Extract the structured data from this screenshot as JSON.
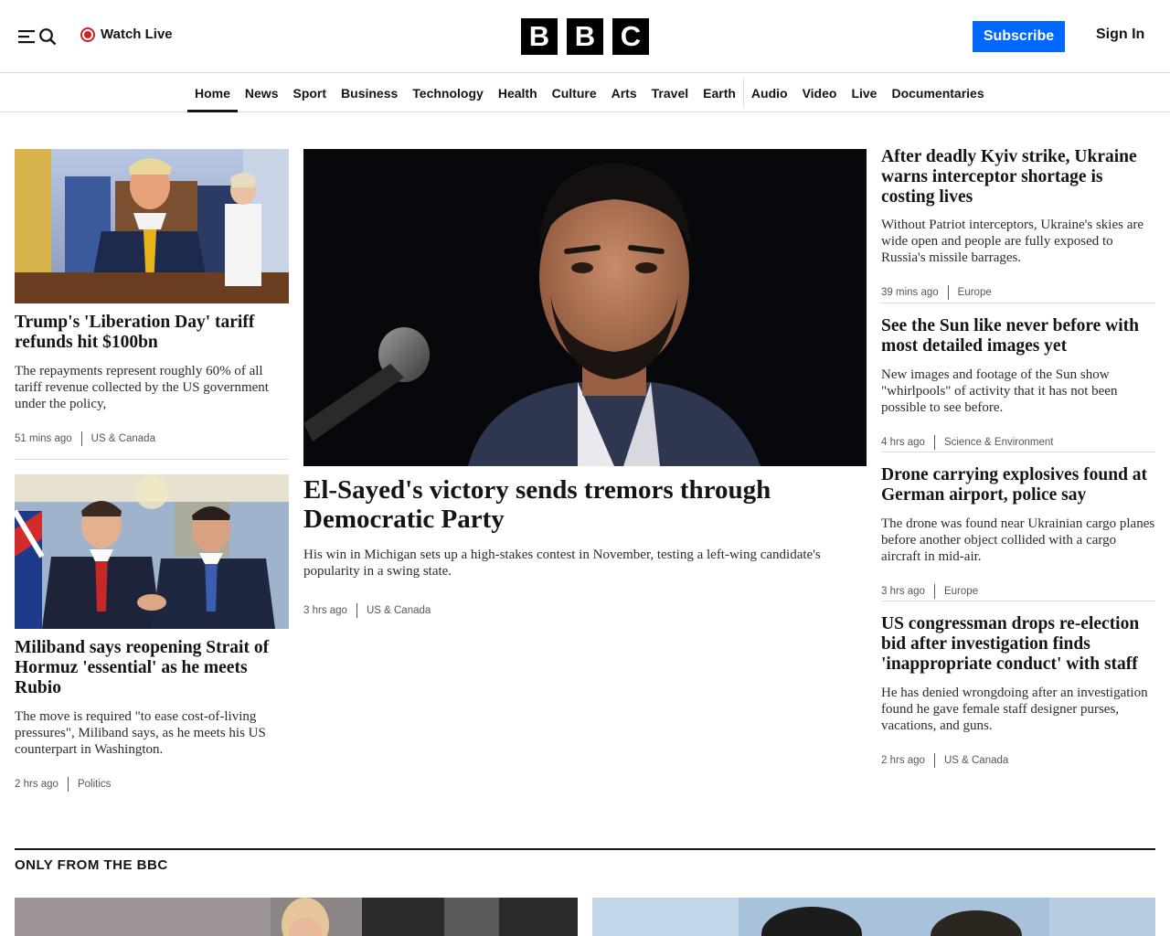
{
  "header": {
    "watch_live": "Watch Live",
    "logo_letters": [
      "B",
      "B",
      "C"
    ],
    "subscribe": "Subscribe",
    "sign_in": "Sign In"
  },
  "nav": {
    "items": [
      "Home",
      "News",
      "Sport",
      "Business",
      "Technology",
      "Health",
      "Culture",
      "Arts",
      "Travel",
      "Earth",
      "Audio",
      "Video",
      "Live",
      "Documentaries"
    ],
    "active": "Home"
  },
  "left_stories": [
    {
      "headline": "Trump's 'Liberation Day' tariff refunds hit $100bn",
      "summary": "The repayments represent roughly 60% of all tariff revenue collected by the US government under the policy,",
      "time": "51 mins ago",
      "section": "US & Canada"
    },
    {
      "headline": "Miliband says reopening Strait of Hormuz 'essential' as he meets Rubio",
      "summary": "The move is required \"to ease cost-of-living pressures\", Miliband says, as he meets his US counterpart in Washington.",
      "time": "2 hrs ago",
      "section": "Politics"
    }
  ],
  "main_story": {
    "headline": "El-Sayed's victory sends tremors through Democratic Party",
    "summary": "His win in Michigan sets up a high-stakes contest in November, testing a left-wing candidate's popularity in a swing state.",
    "time": "3 hrs ago",
    "section": "US & Canada"
  },
  "right_stories": [
    {
      "headline": "After deadly Kyiv strike, Ukraine warns interceptor shortage is costing lives",
      "summary": "Without Patriot interceptors, Ukraine's skies are wide open and people are fully exposed to Russia's missile barrages.",
      "time": "39 mins ago",
      "section": "Europe"
    },
    {
      "headline": "See the Sun like never before with most detailed images yet",
      "summary": "New images and footage of the Sun show \"whirlpools\" of activity that it has not been possible to see before.",
      "time": "4 hrs ago",
      "section": "Science & Environment"
    },
    {
      "headline": "Drone carrying explosives found at German airport, police say",
      "summary": "The drone was found near Ukrainian cargo planes before another object collided with a cargo aircraft in mid-air.",
      "time": "3 hrs ago",
      "section": "Europe"
    },
    {
      "headline": "US congressman drops re-election bid after investigation finds 'inappropriate conduct' with staff",
      "summary": "He has denied wrongdoing after an investigation found he gave female staff designer purses, vacations, and guns.",
      "time": "2 hrs ago",
      "section": "US & Canada"
    }
  ],
  "only_from_bbc": {
    "title": "ONLY FROM THE BBC"
  },
  "icons": {
    "menu": "menu-icon",
    "search": "search-icon",
    "live": "live-dot-icon"
  },
  "colors": {
    "accent": "#0068ff",
    "live": "#d42020",
    "text": "#141414"
  }
}
